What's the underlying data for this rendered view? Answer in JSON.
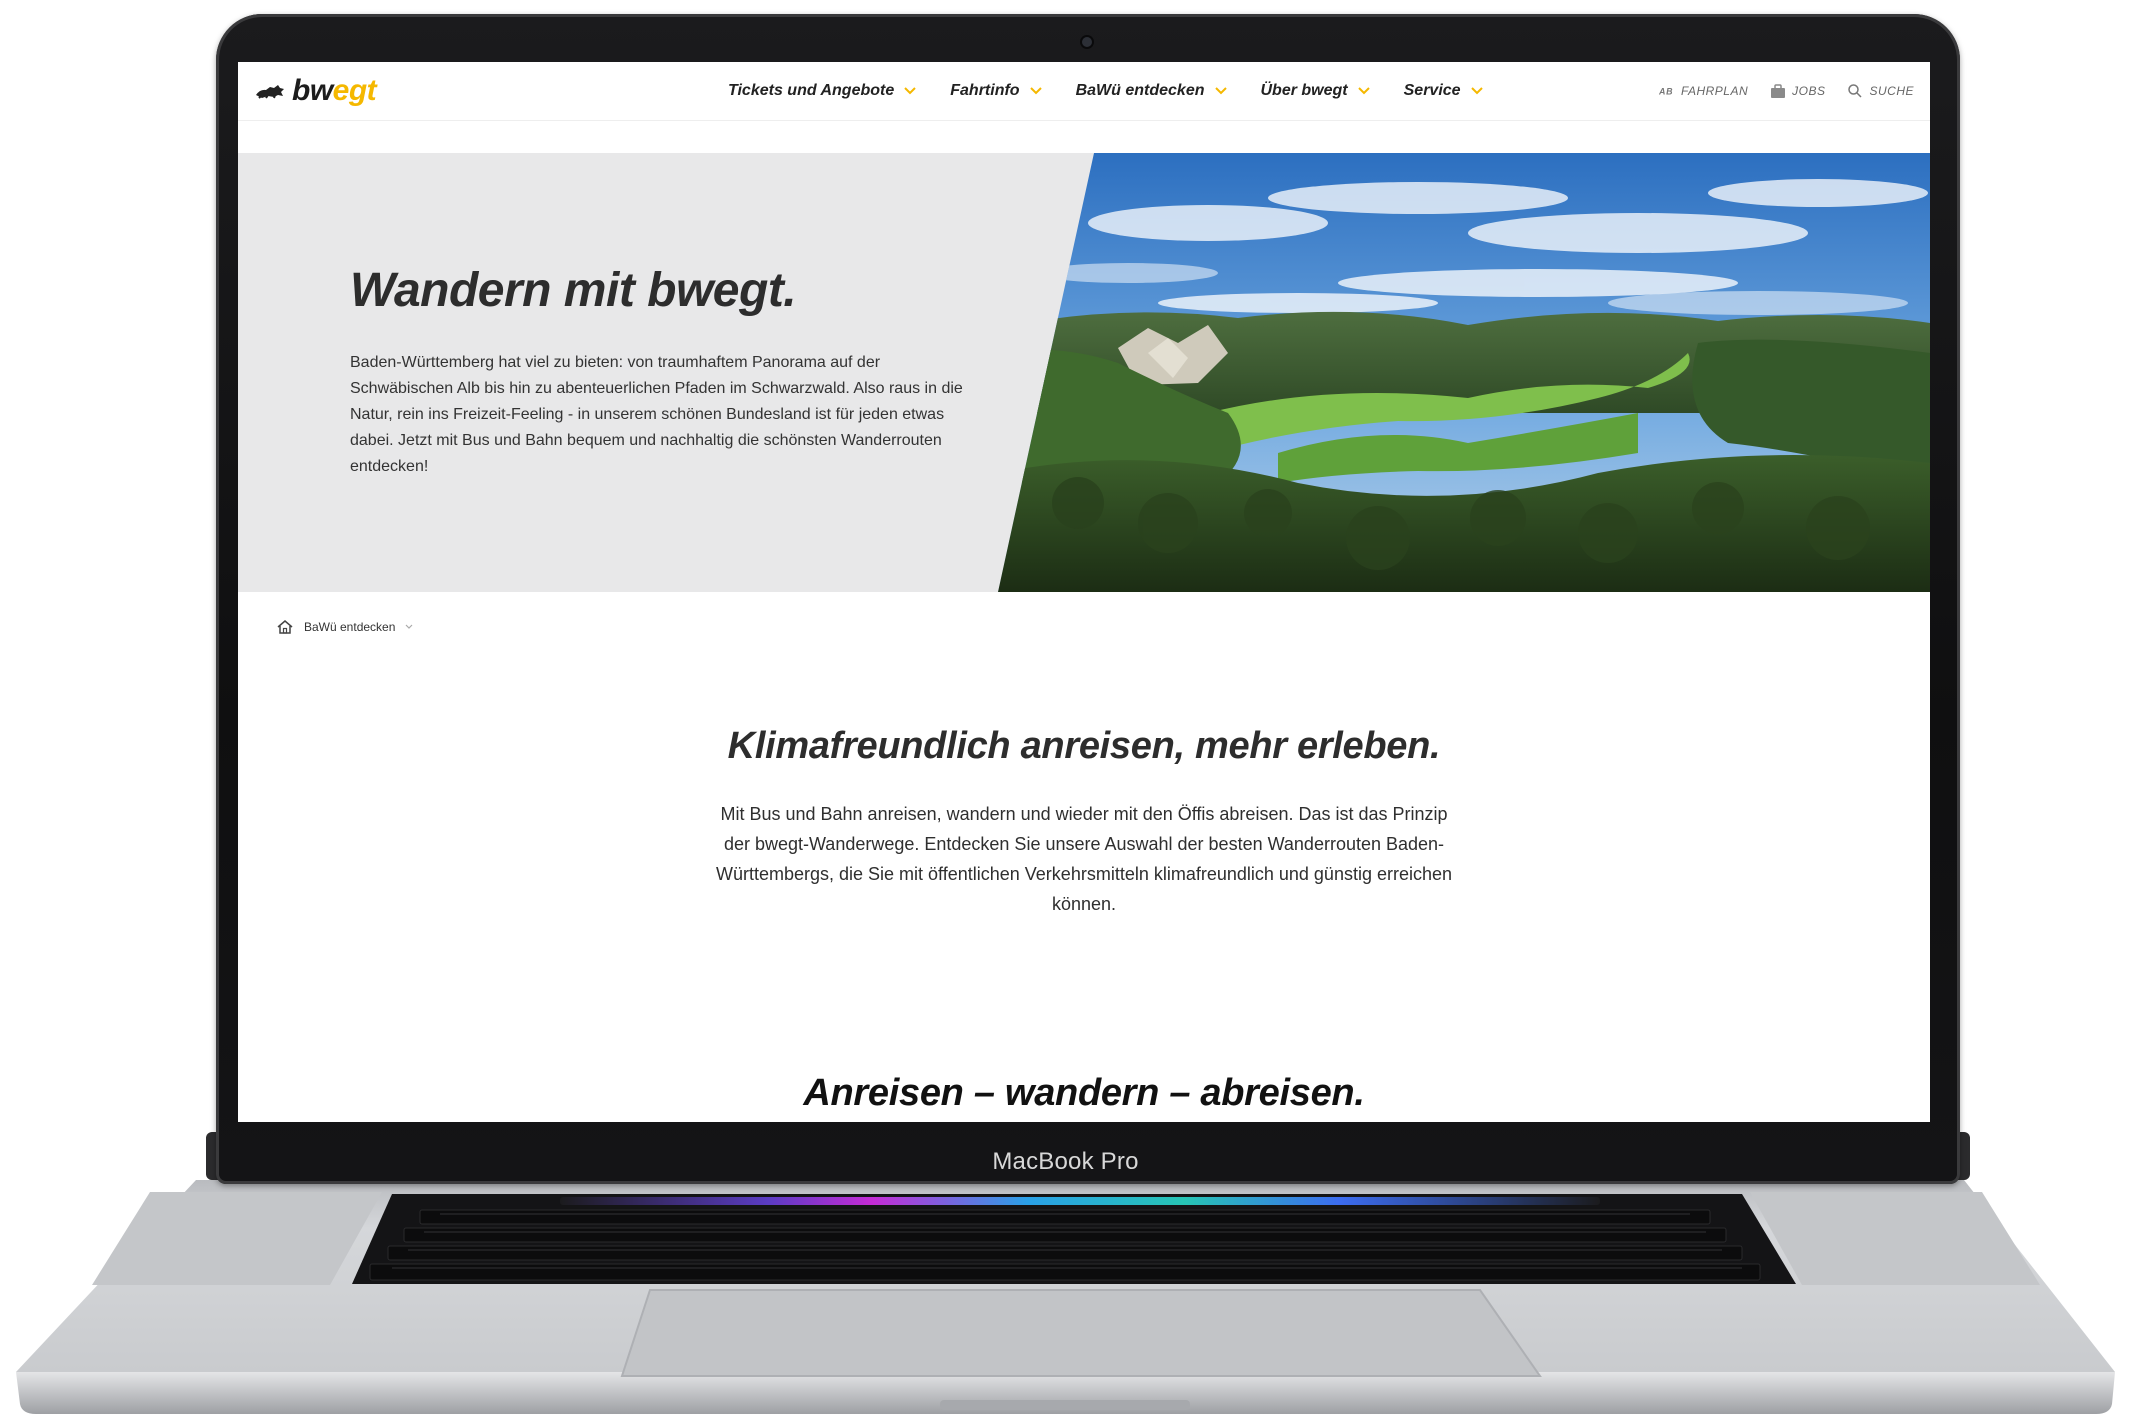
{
  "site": {
    "logo": {
      "part1": "bw",
      "part2": "egt"
    },
    "nav": [
      {
        "label": "Tickets und Angebote"
      },
      {
        "label": "Fahrtinfo"
      },
      {
        "label": "BaWü entdecken"
      },
      {
        "label": "Über bwegt"
      },
      {
        "label": "Service"
      }
    ],
    "utility": {
      "fahrplan": "FAHRPLAN",
      "jobs": "JOBS",
      "suche": "SUCHE"
    }
  },
  "hero": {
    "title": "Wandern mit bwegt.",
    "body": "Baden-Württemberg hat viel zu bieten: von traumhaftem Panorama auf der Schwäbischen Alb bis hin zu abenteuerlichen Pfaden im Schwarzwald. Also raus in die Natur, rein ins Freizeit-Feeling - in unserem schönen Bundesland ist für jeden etwas dabei. Jetzt mit Bus und Bahn bequem und nachhaltig die schönsten Wanderrouten entdecken!"
  },
  "breadcrumb": {
    "item": "BaWü entdecken"
  },
  "section": {
    "title": "Klimafreundlich anreisen, mehr erleben.",
    "body": "Mit Bus und Bahn anreisen, wandern und wieder mit den Öffis abreisen. Das ist das Prinzip der bwegt-Wanderwege. Entdecken Sie unsere Auswahl der besten Wanderrouten Baden-Württembergs, die Sie mit öffentlichen Verkehrsmitteln klimafreundlich und günstig erreichen können."
  },
  "subsection": {
    "title": "Anreisen – wandern – abreisen."
  },
  "device": {
    "label": "MacBook Pro"
  },
  "colors": {
    "brand_yellow": "#f5b800",
    "hero_bg": "#e8e8e9",
    "text_dark": "#2d2d2d"
  }
}
